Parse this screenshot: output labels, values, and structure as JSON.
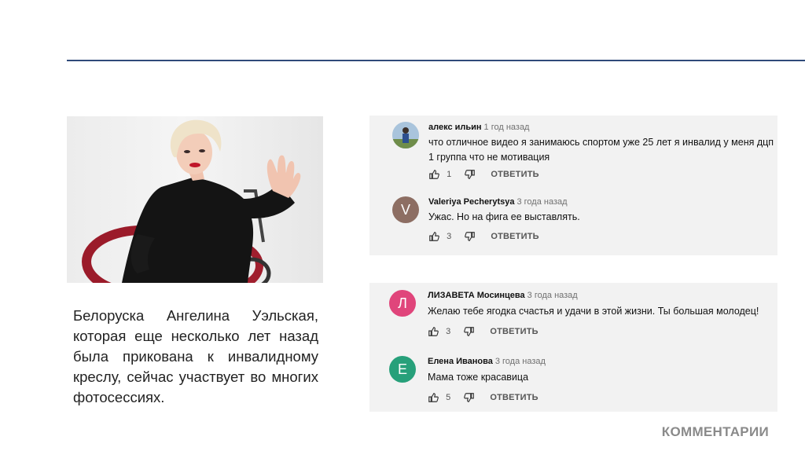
{
  "caption": "Белоруска Ангелина Уэльская, которая еще несколько лет назад была прикована к инвалидному креслу, сейчас участвует во многих фотосессиях.",
  "footer_label": "КОММЕНТАРИИ",
  "reply_label": "ОТВЕТИТЬ",
  "comments": [
    {
      "author": "алекс ильин",
      "time": "1 год назад",
      "text": "что отличное видео я занимаюсь спортом уже 25 лет я инвалид у меня дцп 1 группа что не мотивация",
      "likes": "1",
      "avatar_letter": "",
      "avatar_color": "#6a8aa8"
    },
    {
      "author": "Valeriya Pecherytsya",
      "time": "3 года назад",
      "text": "Ужас. Но на фига ее выставлять.",
      "likes": "3",
      "avatar_letter": "V",
      "avatar_color": "#8d6e63"
    },
    {
      "author": "ЛИЗАВЕТА Мосинцева",
      "time": "3 года назад",
      "text": "Желаю тебе ягодка счастья и удачи в этой жизни. Ты большая молодец!",
      "likes": "3",
      "avatar_letter": "Л",
      "avatar_color": "#e0457b"
    },
    {
      "author": "Елена Иванова",
      "time": "3 года назад",
      "text": "Мама тоже красавица",
      "likes": "5",
      "avatar_letter": "Е",
      "avatar_color": "#27a07a"
    }
  ]
}
